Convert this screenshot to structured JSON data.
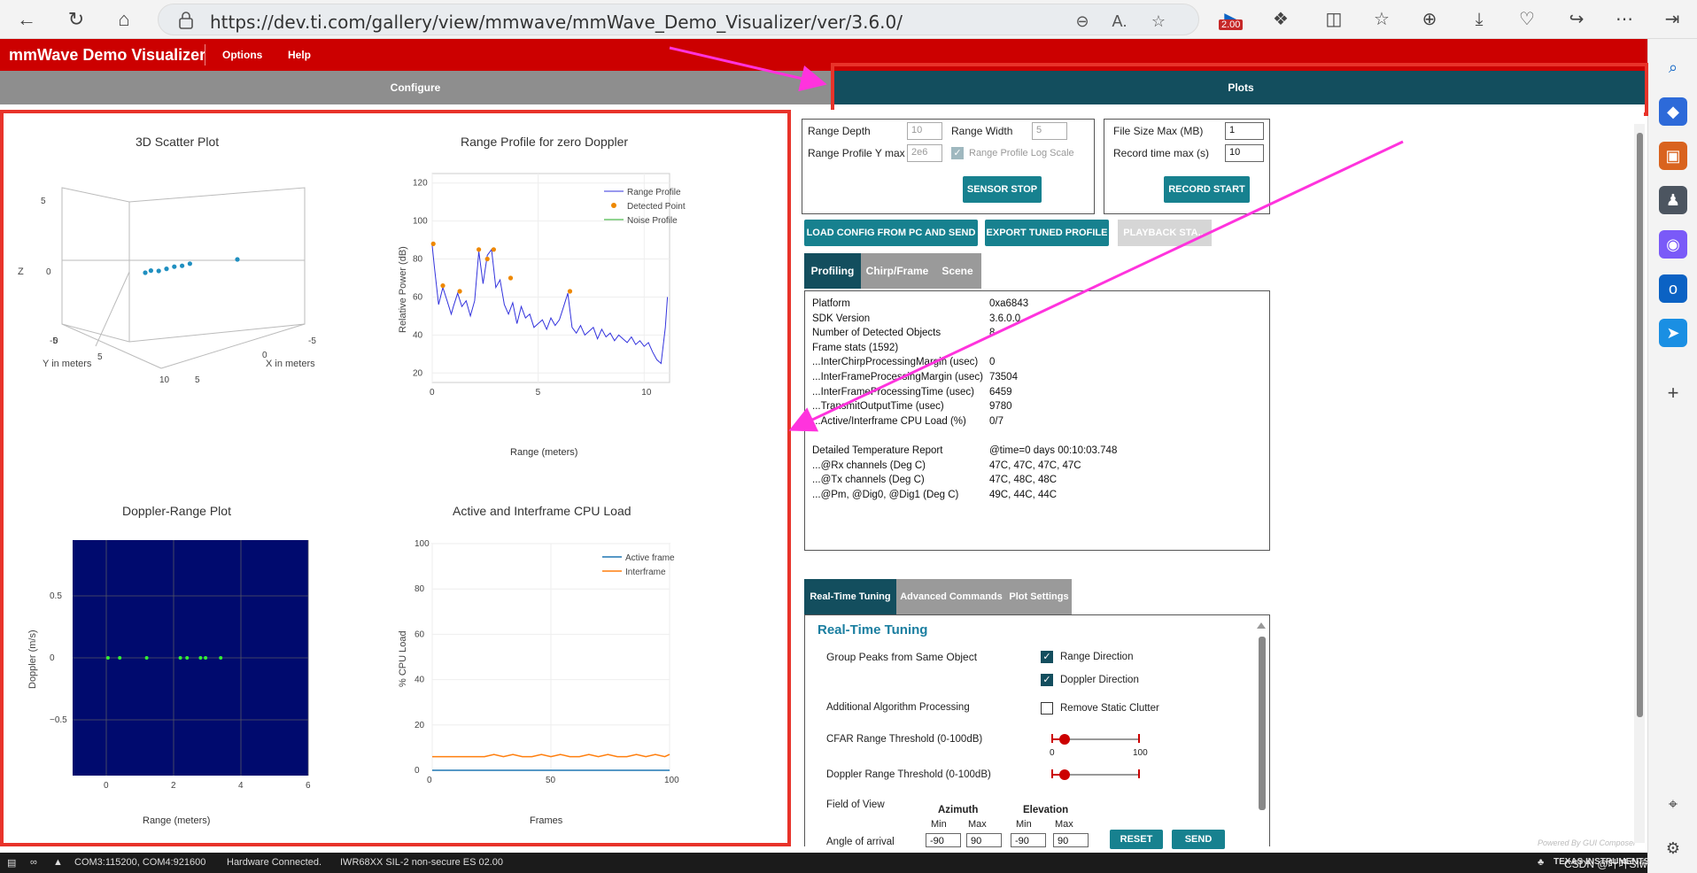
{
  "browser": {
    "url": "https://dev.ti.com/gallery/view/mmwave/mmWave_Demo_Visualizer/ver/3.6.0/",
    "extension_badge": "2.00"
  },
  "app": {
    "title": "mmWave Demo Visualizer",
    "menu": [
      "Options",
      "Help"
    ],
    "tabs": {
      "configure": "Configure",
      "plots": "Plots"
    }
  },
  "plots": {
    "scatter3d": {
      "title": "3D Scatter Plot",
      "z_label": "Z",
      "y_label": "Y in meters",
      "x_label": "X in meters",
      "z_ticks": [
        "5",
        "0",
        "-5"
      ],
      "y_ticks": [
        "0",
        "5",
        "10"
      ],
      "x_ticks": [
        "5",
        "0",
        "-5"
      ]
    },
    "range_profile": {
      "title": "Range Profile for zero Doppler",
      "xlabel": "Range (meters)",
      "ylabel": "Relative Power (dB)",
      "y_ticks": [
        "20",
        "40",
        "60",
        "80",
        "100",
        "120"
      ],
      "x_ticks": [
        "0",
        "5",
        "10"
      ],
      "legend": [
        "Range Profile",
        "Detected Points",
        "Noise Profile"
      ],
      "colors": {
        "range": "#3333dd",
        "detected": "#ee8800",
        "noise": "#22aa22"
      }
    },
    "doppler_range": {
      "title": "Doppler-Range Plot",
      "xlabel": "Range (meters)",
      "ylabel": "Doppler (m/s)",
      "y_ticks": [
        "0.5",
        "0",
        "−0.5"
      ],
      "x_ticks": [
        "0",
        "2",
        "4",
        "6"
      ],
      "background": "#000a6e"
    },
    "cpu_load": {
      "title": "Active and Interframe  CPU Load",
      "xlabel": "Frames",
      "ylabel": "% CPU Load",
      "y_ticks": [
        "0",
        "20",
        "40",
        "60",
        "80",
        "100"
      ],
      "x_ticks": [
        "0",
        "50",
        "100"
      ],
      "legend": [
        "Active frame",
        "Interframe"
      ],
      "colors": {
        "active": "#1f77b4",
        "inter": "#ff7f0e"
      }
    }
  },
  "chart_data": [
    {
      "type": "scatter",
      "title": "3D Scatter Plot",
      "points_xyz": [
        [
          0.5,
          2.0,
          0.0
        ],
        [
          0.4,
          2.5,
          0.1
        ],
        [
          0.2,
          3.0,
          0.0
        ],
        [
          0.0,
          3.5,
          0.1
        ],
        [
          -0.2,
          4.0,
          0.2
        ],
        [
          -0.4,
          4.5,
          0.2
        ],
        [
          -0.6,
          5.0,
          0.3
        ],
        [
          -2.5,
          6.0,
          0.5
        ]
      ],
      "xlabel": "X in meters",
      "ylabel": "Y in meters",
      "zlabel": "Z"
    },
    {
      "type": "line",
      "title": "Range Profile for zero Doppler",
      "xlabel": "Range (meters)",
      "ylabel": "Relative Power (dB)",
      "xlim": [
        0,
        11.2
      ],
      "ylim": [
        15,
        125
      ],
      "series": [
        {
          "name": "Range Profile",
          "x": [
            0,
            0.1,
            0.3,
            0.5,
            0.7,
            0.9,
            1.0,
            1.2,
            1.4,
            1.6,
            1.8,
            2.0,
            2.2,
            2.4,
            2.6,
            2.8,
            3.0,
            3.2,
            3.4,
            3.6,
            3.8,
            4.0,
            4.2,
            4.4,
            4.6,
            4.8,
            5.0,
            5.2,
            5.4,
            5.6,
            5.8,
            6.0,
            6.2,
            6.4,
            6.6,
            6.8,
            7.0,
            7.2,
            7.4,
            7.6,
            7.8,
            8.0,
            8.2,
            8.4,
            8.6,
            8.8,
            9.0,
            9.2,
            9.4,
            9.6,
            9.8,
            10.0,
            10.2,
            10.4,
            10.6,
            10.8,
            11.0,
            11.1
          ],
          "values": [
            87,
            76,
            56,
            65,
            58,
            51,
            55,
            62,
            55,
            58,
            50,
            58,
            84,
            67,
            82,
            85,
            65,
            69,
            56,
            51,
            57,
            46,
            55,
            49,
            51,
            44,
            46,
            48,
            43,
            49,
            45,
            48,
            55,
            62,
            44,
            41,
            45,
            40,
            42,
            44,
            38,
            43,
            39,
            41,
            37,
            40,
            38,
            36,
            39,
            35,
            37,
            34,
            36,
            31,
            27,
            25,
            44,
            60
          ]
        },
        {
          "name": "Detected Points",
          "x": [
            0.05,
            0.5,
            1.3,
            2.2,
            2.6,
            2.9,
            3.7,
            6.5
          ],
          "values": [
            88,
            66,
            63,
            85,
            80,
            85,
            70,
            63
          ]
        },
        {
          "name": "Noise Profile",
          "x": [],
          "values": []
        }
      ]
    },
    {
      "type": "scatter",
      "title": "Doppler-Range Plot",
      "xlabel": "Range (meters)",
      "ylabel": "Doppler (m/s)",
      "xlim": [
        -1,
        6
      ],
      "ylim": [
        -0.95,
        0.95
      ],
      "x": [
        0.05,
        0.4,
        1.2,
        2.2,
        2.4,
        2.8,
        2.95,
        3.4
      ],
      "values": [
        0,
        0,
        0,
        0,
        0,
        0,
        0,
        0
      ]
    },
    {
      "type": "line",
      "title": "Active and Interframe  CPU Load",
      "xlabel": "Frames",
      "ylabel": "% CPU Load",
      "xlim": [
        0,
        100
      ],
      "ylim": [
        0,
        100
      ],
      "series": [
        {
          "name": "Active frame",
          "x": [
            0,
            100
          ],
          "values": [
            0,
            0
          ]
        },
        {
          "name": "Interframe",
          "x": [
            0,
            10,
            20,
            22,
            26,
            30,
            34,
            38,
            42,
            46,
            50,
            54,
            58,
            62,
            66,
            70,
            74,
            78,
            82,
            86,
            90,
            94,
            98,
            100
          ],
          "values": [
            6,
            6,
            6,
            6,
            7,
            6,
            7,
            6,
            6,
            7,
            6,
            7,
            6,
            6,
            7,
            6,
            7,
            6,
            6,
            7,
            6,
            7,
            6,
            7
          ]
        }
      ]
    }
  ],
  "config": {
    "range_depth_label": "Range Depth",
    "range_depth": "10",
    "range_width_label": "Range Width",
    "range_width": "5",
    "range_profile_ymax_label": "Range Profile Y max",
    "range_profile_ymax": "2e6",
    "log_scale_label": "Range Profile Log Scale",
    "sensor_stop": "SENSOR STOP",
    "file_size_label": "File Size Max (MB)",
    "file_size": "1",
    "record_time_label": "Record time max (s)",
    "record_time": "10",
    "record_start": "RECORD START",
    "load_config": "LOAD CONFIG FROM PC AND SEND",
    "export_profile": "EXPORT TUNED PROFILE",
    "playback": "PLAYBACK STA..."
  },
  "profiling_tabs": [
    "Profiling",
    "Chirp/Frame",
    "Scene"
  ],
  "stats": [
    {
      "label": "Platform",
      "value": "0xa6843"
    },
    {
      "label": "SDK Version",
      "value": "3.6.0.0"
    },
    {
      "label": "Number of Detected Objects",
      "value": "8"
    },
    {
      "label": "Frame stats (1592)",
      "value": ""
    },
    {
      "label": "...InterChirpProcessingMargin (usec)",
      "value": "0"
    },
    {
      "label": "...InterFrameProcessingMargin (usec)",
      "value": "73504"
    },
    {
      "label": "...InterFrameProcessingTime (usec)",
      "value": "6459"
    },
    {
      "label": "...TransmitOutputTime (usec)",
      "value": "9780"
    },
    {
      "label": "...Active/Interframe CPU Load (%)",
      "value": "0/7"
    },
    {
      "label": "",
      "value": ""
    },
    {
      "label": "Detailed Temperature Report",
      "value": "@time=0 days 00:10:03.748"
    },
    {
      "label": "...@Rx channels (Deg C)",
      "value": "47C, 47C, 47C, 47C"
    },
    {
      "label": "...@Tx channels (Deg C)",
      "value": "47C, 48C, 48C"
    },
    {
      "label": "...@Pm, @Dig0, @Dig1 (Deg C)",
      "value": "49C, 44C, 44C"
    }
  ],
  "tuning_tabs": [
    "Real-Time Tuning",
    "Advanced Commands",
    "Plot Settings"
  ],
  "tuning": {
    "heading": "Real-Time Tuning",
    "group_peaks": "Group Peaks from Same Object",
    "range_direction": "Range Direction",
    "doppler_direction": "Doppler Direction",
    "additional": "Additional Algorithm Processing",
    "remove_clutter": "Remove Static Clutter",
    "cfar_range": "CFAR Range Threshold (0-100dB)",
    "doppler_range": "Doppler Range Threshold (0-100dB)",
    "slider_min": "0",
    "slider_max": "100",
    "cfar_level": 0.15,
    "doppler_level": 0.15,
    "fov": "Field of View",
    "azimuth": "Azimuth",
    "elevation": "Elevation",
    "min": "Min",
    "max": "Max",
    "angle_of_arrival": "Angle of arrival",
    "az_min": "-90",
    "az_max": "90",
    "el_min": "-90",
    "el_max": "90",
    "reset": "RESET",
    "send": "SEND",
    "powered_by": "Powered By GUI Composer"
  },
  "status": {
    "ports": "COM3:115200, COM4:921600",
    "hardware": "Hardware Connected.",
    "device": "IWR68XX SIL-2 non-secure ES 02.00",
    "brand": "TEXAS INSTRUMENTS",
    "watermark": "CSDN @叶叶Šİŵ"
  },
  "colors": {
    "ti_red": "#cc0000",
    "teal": "#134e5e",
    "button_teal": "#17818f",
    "annotation": "#e8332a",
    "arrow": "#ff33dd"
  }
}
